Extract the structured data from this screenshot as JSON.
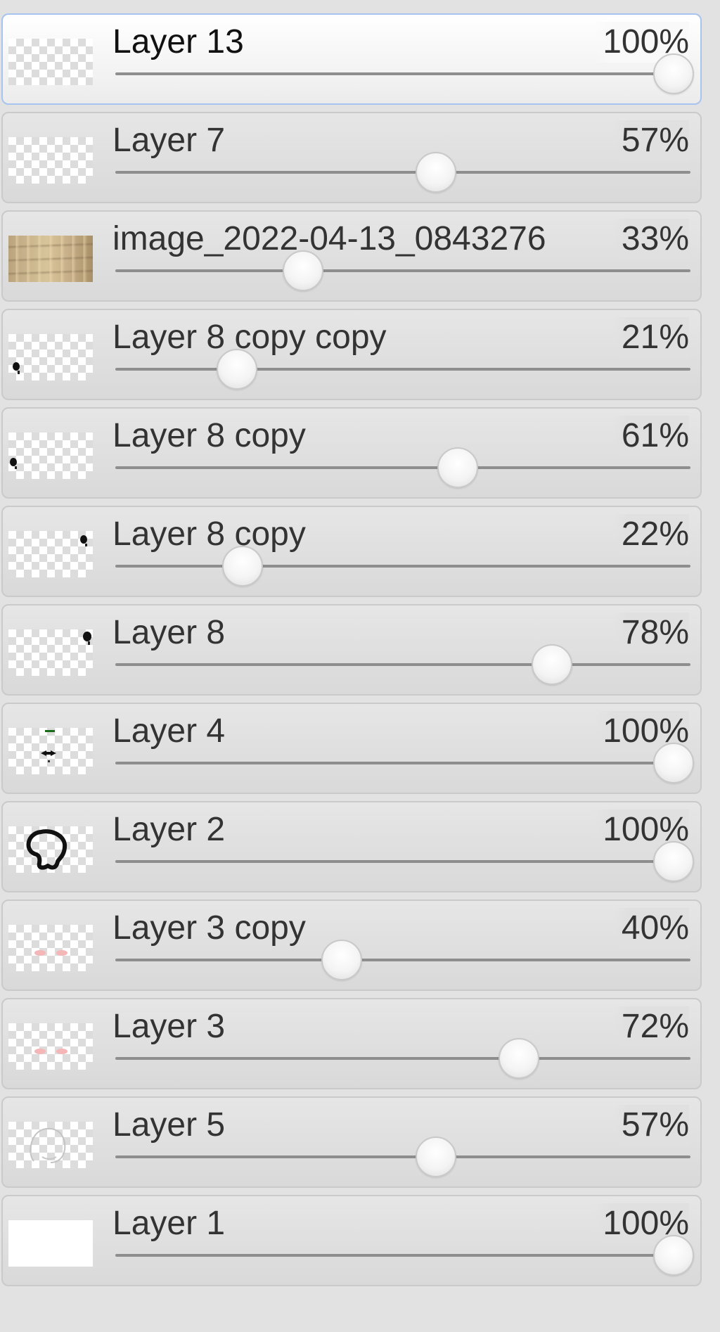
{
  "layers": [
    {
      "name": "Layer 13",
      "opacity_label": "100%",
      "opacity": 100,
      "selected": true,
      "thumb": "empty"
    },
    {
      "name": "Layer 7",
      "opacity_label": "57%",
      "opacity": 57,
      "selected": false,
      "thumb": "empty"
    },
    {
      "name": "image_2022-04-13_0843276",
      "opacity_label": "33%",
      "opacity": 33,
      "selected": false,
      "thumb": "photo"
    },
    {
      "name": "Layer 8 copy copy",
      "opacity_label": "21%",
      "opacity": 21,
      "selected": false,
      "thumb": "dot-left-lower"
    },
    {
      "name": "Layer 8 copy",
      "opacity_label": "61%",
      "opacity": 61,
      "selected": false,
      "thumb": "dot-left-mid"
    },
    {
      "name": "Layer 8 copy",
      "opacity_label": "22%",
      "opacity": 22,
      "selected": false,
      "thumb": "dot-right-top"
    },
    {
      "name": "Layer 8",
      "opacity_label": "78%",
      "opacity": 78,
      "selected": false,
      "thumb": "dot-right-top2"
    },
    {
      "name": "Layer 4",
      "opacity_label": "100%",
      "opacity": 100,
      "selected": false,
      "thumb": "face-features"
    },
    {
      "name": "Layer 2",
      "opacity_label": "100%",
      "opacity": 100,
      "selected": false,
      "thumb": "outline"
    },
    {
      "name": "Layer 3 copy",
      "opacity_label": "40%",
      "opacity": 40,
      "selected": false,
      "thumb": "pink-cheeks"
    },
    {
      "name": "Layer 3",
      "opacity_label": "72%",
      "opacity": 72,
      "selected": false,
      "thumb": "pink-cheeks"
    },
    {
      "name": "Layer 5",
      "opacity_label": "57%",
      "opacity": 57,
      "selected": false,
      "thumb": "faint-sketch"
    },
    {
      "name": "Layer 1",
      "opacity_label": "100%",
      "opacity": 100,
      "selected": false,
      "thumb": "white"
    }
  ]
}
